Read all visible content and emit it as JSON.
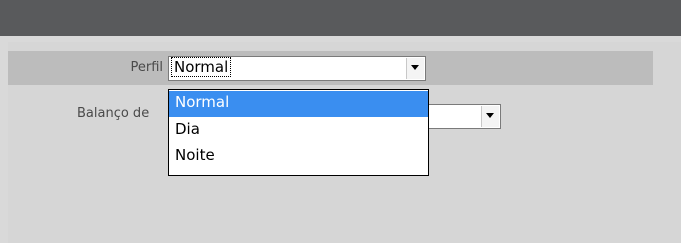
{
  "form": {
    "perfil_label": "Perfil",
    "perfil_value": "Normal",
    "balanco_label": "Balanço de",
    "balanco_value": ""
  },
  "dropdown": {
    "options": [
      "Normal",
      "Dia",
      "Noite"
    ],
    "selected_index": 0
  },
  "colors": {
    "top_bar": "#595a5c",
    "highlight_row": "#bcbcbc",
    "selected_option": "#3a8ef0"
  },
  "icons": {
    "select_arrow": "chevron-down-icon"
  }
}
